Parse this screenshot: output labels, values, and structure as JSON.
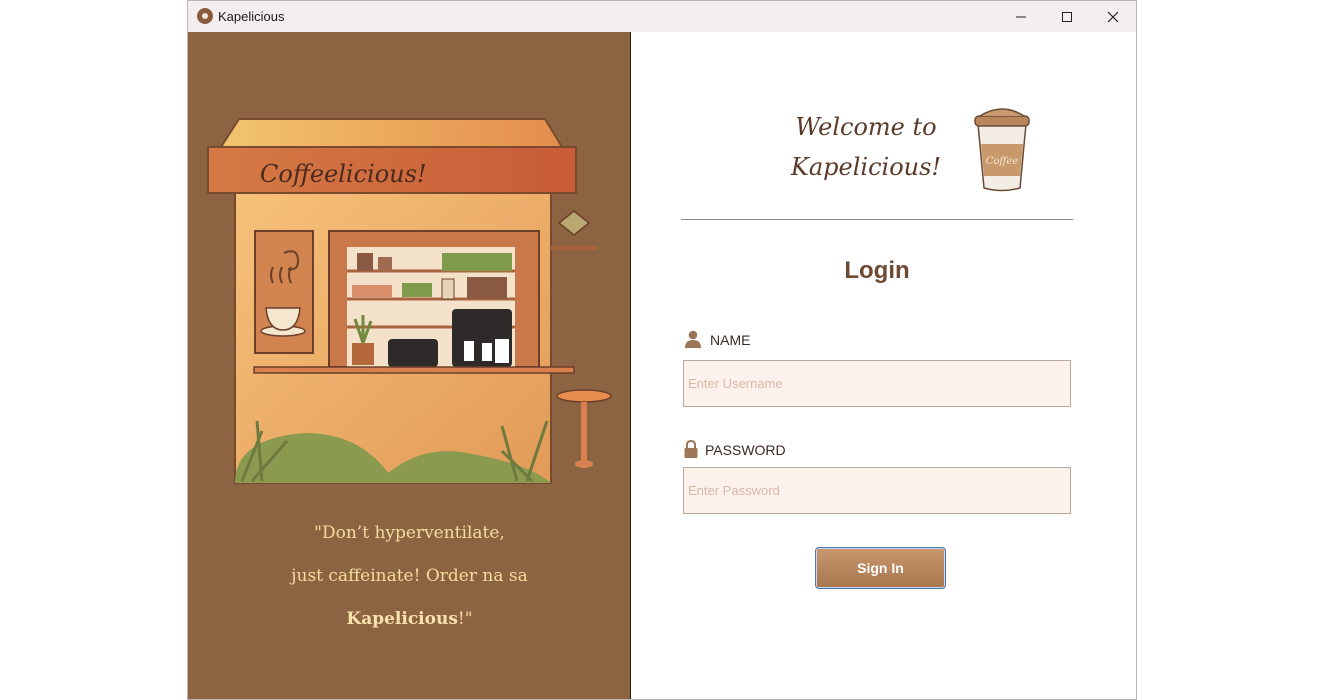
{
  "window": {
    "title": "Kapelicious"
  },
  "left": {
    "sign_text": "Coffeelicious!",
    "quote_line1": "\"Don’t hyperventilate,",
    "quote_line2": "just caffeinate! Order na sa",
    "quote_brand": "Kapelicious",
    "quote_end": "!\""
  },
  "header": {
    "welcome_line1": "Welcome to",
    "welcome_line2": "Kapelicious!",
    "cup_label": "Coffee"
  },
  "form": {
    "title": "Login",
    "name_label": "NAME",
    "name_placeholder": "Enter Username",
    "password_label": "PASSWORD",
    "password_placeholder": "Enter Password",
    "signin_label": "Sign In"
  },
  "colors": {
    "panel_brown": "#8d6442",
    "accent": "#6e4a33",
    "input_bg": "#fdf1ec"
  }
}
